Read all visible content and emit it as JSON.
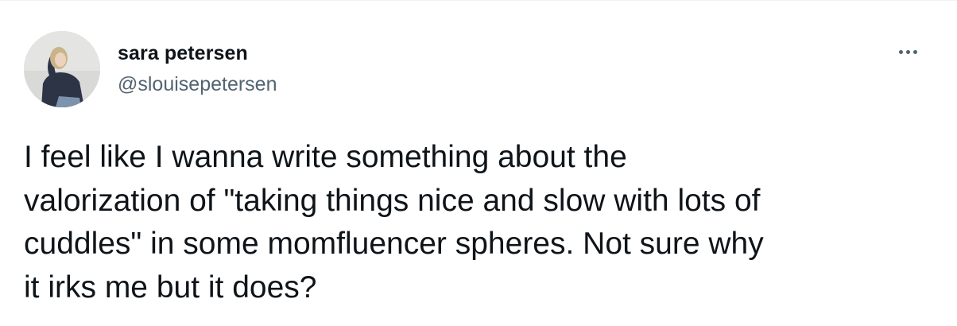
{
  "tweet": {
    "author": {
      "display_name": "sara petersen",
      "handle": "@slouisepetersen",
      "avatar_icon": "profile-photo"
    },
    "more_icon": "ellipsis-icon",
    "text": "I feel like I wanna write something about the\nvalorization of \"taking things nice and slow with lots of\ncuddles\" in some momfluencer spheres. Not sure why\nit irks me but it does?"
  },
  "colors": {
    "text_primary": "#0f1419",
    "text_secondary": "#536471",
    "background": "#ffffff"
  }
}
